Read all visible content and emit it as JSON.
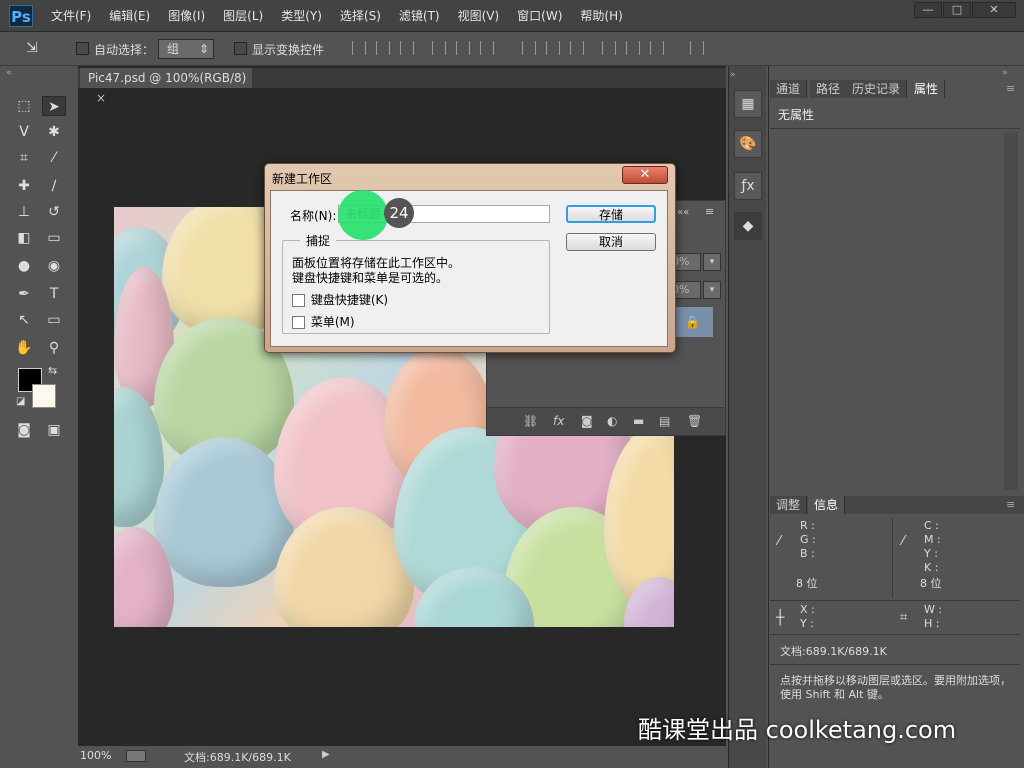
{
  "app": {
    "logo": "Ps",
    "window_controls": [
      "—",
      "□",
      "✕"
    ]
  },
  "menu": [
    "文件(F)",
    "编辑(E)",
    "图像(I)",
    "图层(L)",
    "类型(Y)",
    "选择(S)",
    "滤镜(T)",
    "视图(V)",
    "窗口(W)",
    "帮助(H)"
  ],
  "options": {
    "auto_select_label": "自动选择：",
    "auto_select_value": "组",
    "show_transform_label": "显示变换控件"
  },
  "document": {
    "tab_title": "Pic47.psd @ 100%(RGB/8)",
    "tab_close": "×",
    "zoom": "100%",
    "doc_info": "文档:689.1K/689.1K"
  },
  "dialog": {
    "title": "新建工作区",
    "close": "✕",
    "name_label": "名称(N):",
    "name_value": "未标题-1",
    "save_button": "存储",
    "cancel_button": "取消",
    "group_title": "捕捉",
    "group_text_1": "面板位置将存储在此工作区中。",
    "group_text_2": "键盘快捷键和菜单是可选的。",
    "chk_keyboard": "键盘快捷键(K)",
    "chk_menu": "菜单(M)",
    "step_badge": "24"
  },
  "right_panel": {
    "top_tabs": [
      "通道",
      "路径",
      "历史记录",
      "属性"
    ],
    "no_properties": "无属性",
    "bottom_tabs": [
      "调整",
      "信息"
    ],
    "info_left": [
      "R :",
      "G :",
      "B :"
    ],
    "info_right": [
      "C :",
      "M :",
      "Y :",
      "K :"
    ],
    "bits_left": "8 位",
    "bits_right": "8 位",
    "xy": [
      "X :",
      "Y :"
    ],
    "wh": [
      "W :",
      "H :"
    ],
    "doc_info": "文档:689.1K/689.1K",
    "hint": "点按并拖移以移动图层或选区。要用附加选项，使用 Shift 和 Alt 键。"
  },
  "layers_panel": {
    "opacity_1": "0%",
    "opacity_2": "0%"
  },
  "watermark": "酷课堂出品 coolketang.com"
}
